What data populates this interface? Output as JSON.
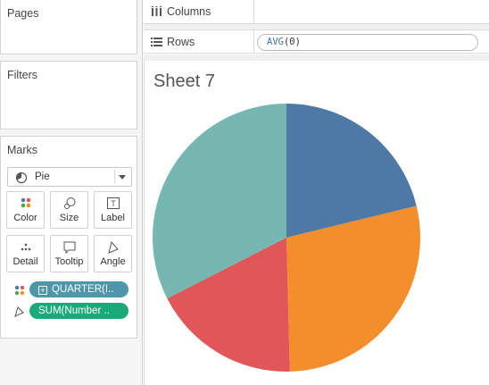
{
  "left_panel": {
    "pages_title": "Pages",
    "filters_title": "Filters",
    "marks_title": "Marks",
    "mark_type": "Pie",
    "buttons": {
      "color": "Color",
      "size": "Size",
      "label": "Label",
      "detail": "Detail",
      "tooltip": "Tooltip",
      "angle": "Angle"
    },
    "pills": {
      "color_pill": "QUARTER(I..",
      "angle_pill": "SUM(Number .."
    }
  },
  "shelves": {
    "columns_label": "Columns",
    "rows_label": "Rows",
    "rows_pill_fn": "AVG",
    "rows_pill_arg": "(0)"
  },
  "sheet": {
    "title": "Sheet 7"
  },
  "chart_data": {
    "type": "pie",
    "values": [
      21.2,
      28.4,
      17.9,
      32.5
    ],
    "colors": [
      "#4e79a7",
      "#f28e2b",
      "#e15759",
      "#76b7b2"
    ]
  },
  "colors": {
    "blue_pill": "#4e96aa",
    "green_pill": "#1aa979"
  }
}
